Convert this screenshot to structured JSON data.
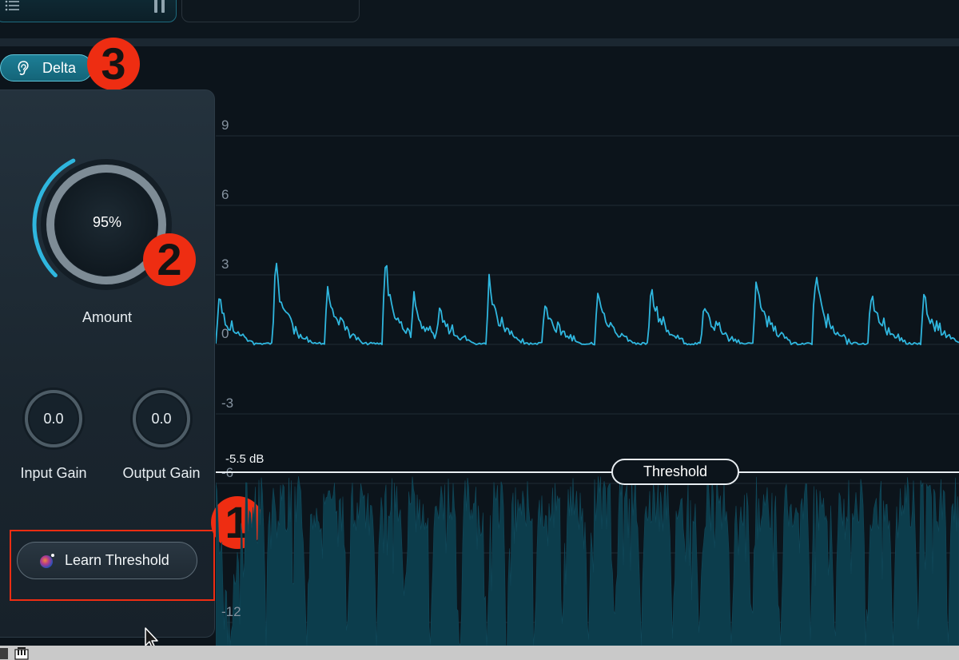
{
  "delta": {
    "label": "Delta"
  },
  "annotations": {
    "one": "1",
    "two": "2",
    "three": "3"
  },
  "amount": {
    "value": "95%",
    "label": "Amount",
    "level": 0.95
  },
  "input_gain": {
    "value": "0.0",
    "label": "Input Gain"
  },
  "output_gain": {
    "value": "0.0",
    "label": "Output Gain"
  },
  "learn_threshold": {
    "label": "Learn Threshold"
  },
  "graph": {
    "y_ticks": [
      "9",
      "6",
      "3",
      "0",
      "-3",
      "-6",
      "-12"
    ],
    "threshold_value": "-5.5 dB",
    "threshold_label": "Threshold"
  },
  "colors": {
    "accent": "#29b4d8",
    "waveform_fill": "#0c3d4c",
    "annotation": "#ee2d12",
    "background": "#0c141b"
  },
  "icons": [
    "list-icon",
    "pause-icon",
    "ear-icon",
    "learn-orb-icon",
    "mouse-cursor-icon"
  ]
}
